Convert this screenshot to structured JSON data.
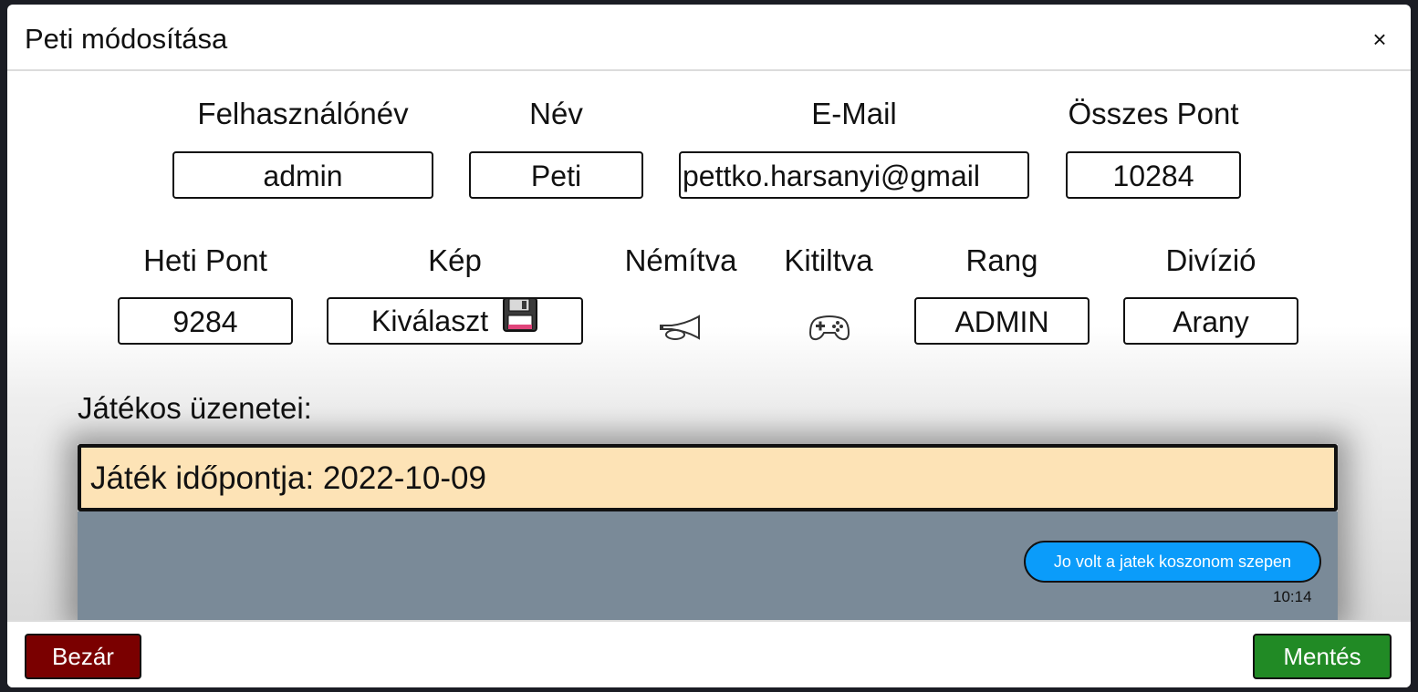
{
  "modal": {
    "title": "Peti módosítása",
    "close_symbol": "×"
  },
  "fields": {
    "username": {
      "label": "Felhasználónév",
      "value": "admin"
    },
    "name": {
      "label": "Név",
      "value": "Peti"
    },
    "email": {
      "label": "E-Mail",
      "value": "pettko.harsanyi@gmail"
    },
    "total_points": {
      "label": "Összes Pont",
      "value": "10284"
    },
    "weekly_points": {
      "label": "Heti Pont",
      "value": "9284"
    },
    "picture": {
      "label": "Kép",
      "button_label": "Kiválaszt",
      "icon": "floppy-disk-icon"
    },
    "muted": {
      "label": "Némítva",
      "icon": "horn-icon"
    },
    "banned": {
      "label": "Kitiltva",
      "icon": "gamepad-icon"
    },
    "rank": {
      "label": "Rang",
      "value": "ADMIN"
    },
    "division": {
      "label": "Divízió",
      "value": "Arany"
    }
  },
  "messages": {
    "label": "Játékos üzenetei:",
    "game_date": "Játék időpontja: 2022-10-09",
    "items": [
      {
        "text": "Jo volt a jatek koszonom szepen",
        "time": "10:14"
      }
    ]
  },
  "footer": {
    "close_label": "Bezár",
    "save_label": "Mentés"
  },
  "colors": {
    "chat_header_bg": "#fde3b6",
    "chat_bg": "#7a8a98",
    "bubble_bg": "#0b9cfa",
    "close_button_bg": "#7a0000",
    "save_button_bg": "#218a25"
  }
}
